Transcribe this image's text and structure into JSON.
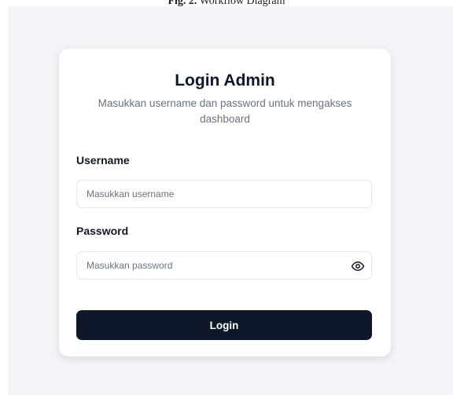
{
  "caption": {
    "fig_label": "Fig. 2.",
    "fig_text": " Workflow Diagram"
  },
  "login": {
    "title": "Login Admin",
    "subtitle": "Masukkan username dan password untuk mengakses dashboard",
    "username_label": "Username",
    "username_placeholder": "Masukkan username",
    "password_label": "Password",
    "password_placeholder": "Masukkan password",
    "password_toggle_icon": "eye-icon",
    "submit_label": "Login"
  },
  "colors": {
    "background": "#f3f4f7",
    "card": "#ffffff",
    "button": "#0f172a",
    "muted_text": "#6b7280"
  }
}
